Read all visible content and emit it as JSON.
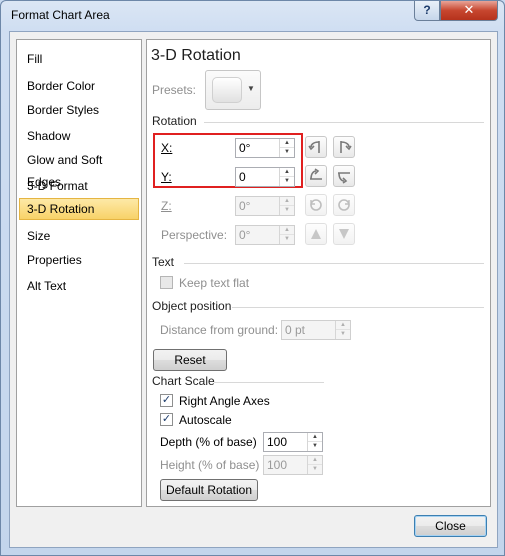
{
  "window": {
    "title": "Format Chart Area",
    "help_label": "?",
    "close_label": "✕"
  },
  "nav": {
    "items": [
      {
        "label": "Fill"
      },
      {
        "label": "Border Color"
      },
      {
        "label": "Border Styles"
      },
      {
        "label": "Shadow"
      },
      {
        "label": "Glow and Soft Edges"
      },
      {
        "label": "3-D Format"
      },
      {
        "label": "3-D Rotation",
        "selected": true
      },
      {
        "label": "Size"
      },
      {
        "label": "Properties"
      },
      {
        "label": "Alt Text"
      }
    ]
  },
  "panel": {
    "heading": "3-D Rotation",
    "presets_label": "Presets:",
    "rotation_section": "Rotation",
    "x_label": "X:",
    "x_value": "0°",
    "y_label": "Y:",
    "y_value": "0",
    "z_label": "Z:",
    "z_value": "0°",
    "perspective_label": "Perspective:",
    "perspective_value": "0°",
    "text_section": "Text",
    "keep_text_flat_label": "Keep text flat",
    "object_position_section": "Object position",
    "distance_label": "Distance from ground:",
    "distance_value": "0 pt",
    "reset_label": "Reset",
    "chart_scale_section": "Chart Scale",
    "right_angle_axes_label": "Right Angle Axes",
    "right_angle_axes_checked": true,
    "autoscale_label": "Autoscale",
    "autoscale_checked": true,
    "depth_label": "Depth (% of base)",
    "depth_value": "100",
    "height_label": "Height (% of base)",
    "height_value": "100",
    "default_rotation_label": "Default Rotation"
  },
  "footer": {
    "close_label": "Close"
  },
  "colors": {
    "selection": "#f8d268",
    "highlight_box": "#e02020"
  }
}
